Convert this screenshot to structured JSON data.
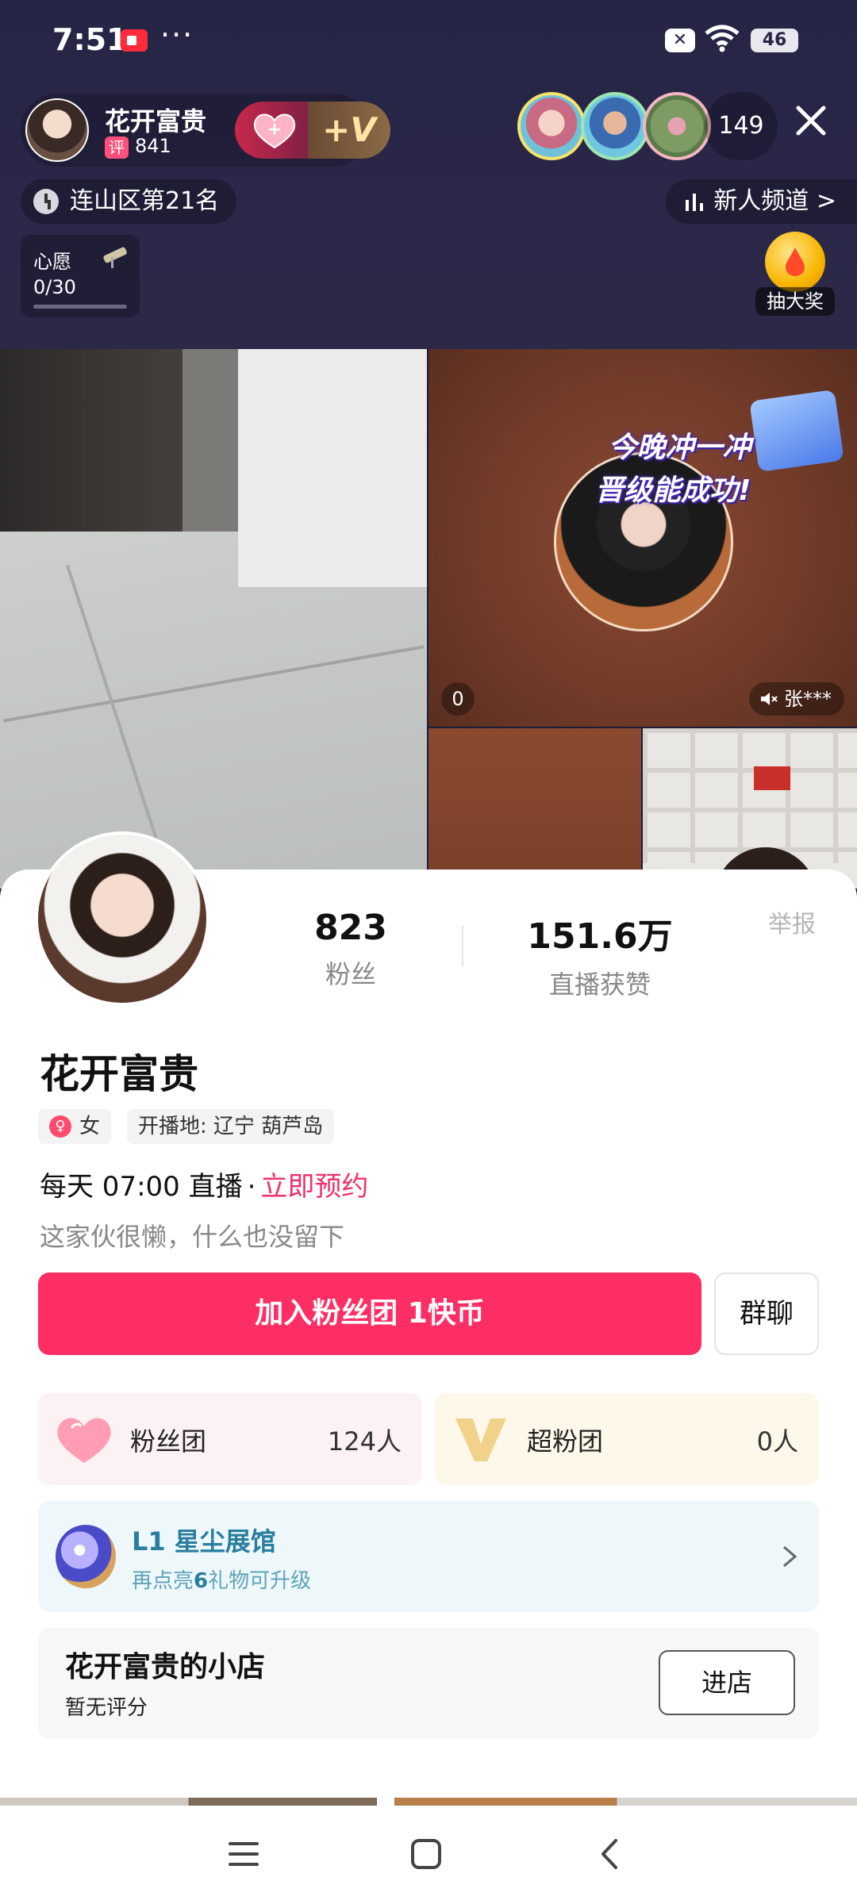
{
  "status_bar": {
    "time": "7:51",
    "dots": "···",
    "notif_x": "✕",
    "battery": "46"
  },
  "host": {
    "name": "花开富贵",
    "ping_badge": "评",
    "score": "841",
    "v_button": "+V"
  },
  "viewers": {
    "count": "149"
  },
  "rank": {
    "label": "连山区第21名"
  },
  "channel": {
    "label": "新人频道 >"
  },
  "wish": {
    "title": "心愿",
    "progress": "0/30"
  },
  "lottery": {
    "label": "抽大奖"
  },
  "banner": {
    "line1": "今晚冲一冲",
    "line2": "晋级能成功!"
  },
  "video": {
    "left_count": "0",
    "muted_user": "张***"
  },
  "profile": {
    "fans_count": "823",
    "fans_label": "粉丝",
    "likes_count": "151.6万",
    "likes_label": "直播获赞",
    "report": "举报",
    "name": "花开富贵",
    "gender_symbol": "♀",
    "gender": "女",
    "location": "开播地: 辽宁 葫芦岛",
    "schedule": "每天 07:00 直播",
    "schedule_sep": "·",
    "reserve": "立即预约",
    "bio": "这家伙很懒，什么也没留下"
  },
  "actions": {
    "join": "加入粉丝团 1快币",
    "group_chat": "群聊"
  },
  "clubs": {
    "fan": {
      "name": "粉丝团",
      "count": "124人"
    },
    "super": {
      "name": "超粉团",
      "count": "0人"
    }
  },
  "gallery": {
    "title": "L1 星尘展馆",
    "sub_prefix": "再点亮",
    "sub_num": "6",
    "sub_suffix": "礼物可升级"
  },
  "shop": {
    "title": "花开富贵的小店",
    "rating": "暂无评分",
    "enter": "进店"
  },
  "colors": {
    "accent": "#fd2e64",
    "reserve": "#f0306a",
    "gallery_text": "#2a7e9f"
  }
}
